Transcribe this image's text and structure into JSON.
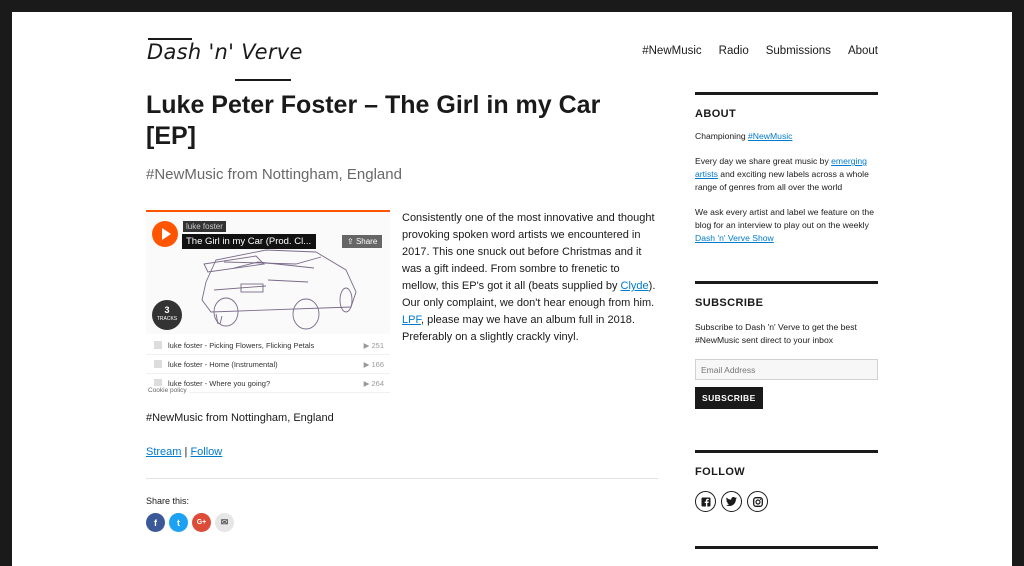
{
  "site": {
    "logo": "Dash 'n' Verve"
  },
  "nav": [
    "#NewMusic",
    "Radio",
    "Submissions",
    "About"
  ],
  "post": {
    "title": "Luke Peter Foster – The Girl in my Car [EP]",
    "subtitle": "#NewMusic from Nottingham, England",
    "player": {
      "artist": "luke foster",
      "track": "The Girl in my Car (Prod. Cl...",
      "share": "Share",
      "count": "3",
      "count_label": "TRACKS",
      "tracks": [
        {
          "name": "luke foster - Picking Flowers, Flicking Petals",
          "plays": "251"
        },
        {
          "name": "luke foster - Home (Instrumental)",
          "plays": "166"
        },
        {
          "name": "luke foster - Where you going?",
          "plays": "264"
        }
      ],
      "cookie": "Cookie policy"
    },
    "body": {
      "t1": "Consistently one of the most innovative and thought provoking spoken word artists we encountered in 2017. This one snuck out before Christmas and it was a gift indeed. From sombre to frenetic to mellow, this EP's got it all (beats supplied by ",
      "link1": "Clyde",
      "t2": "). Our only complaint, we don't hear enough from him. ",
      "link2": "LPF",
      "t3": ", please may we have an album full in 2018. Preferably on a slightly crackly vinyl."
    },
    "caption": "#NewMusic from Nottingham, England",
    "stream": "Stream",
    "sep": "|",
    "follow": "Follow",
    "share_label": "Share this:"
  },
  "sidebar": {
    "about": {
      "title": "ABOUT",
      "p1_text": "Championing ",
      "p1_link": "#NewMusic",
      "p2_a": "Every day we share great music by ",
      "p2_link": "emerging artists",
      "p2_b": " and exciting new labels across a whole range of genres from all over the world",
      "p3_a": "We ask every artist and label we feature on the blog for an interview to play out on the weekly ",
      "p3_link": "Dash 'n' Verve Show"
    },
    "subscribe": {
      "title": "SUBSCRIBE",
      "text": "Subscribe to Dash 'n' Verve to get the best #NewMusic sent direct to your inbox",
      "placeholder": "Email Address",
      "button": "SUBSCRIBE"
    },
    "follow": {
      "title": "FOLLOW"
    }
  },
  "colors": {
    "accent": "#007acc",
    "soundcloud": "#ff5500",
    "facebook": "#3b5998",
    "twitter": "#1da1f2",
    "google": "#dd4b39"
  }
}
